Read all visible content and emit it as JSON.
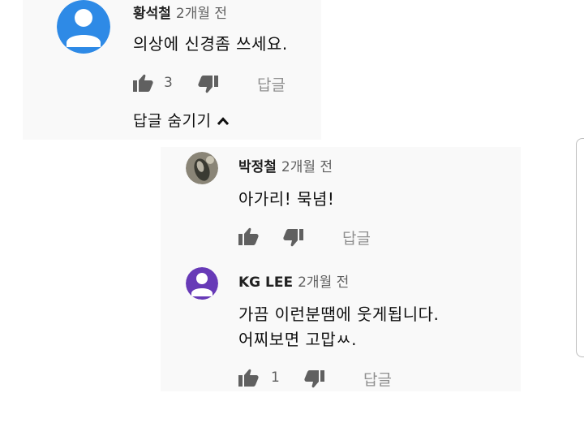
{
  "colors": {
    "avatar_blue": "#2e8ae6",
    "avatar_purple": "#673ab7",
    "icon_gray": "#606060",
    "panel_bg": "#f9f9f9"
  },
  "comment": {
    "author": "황석철",
    "time": "2개월 전",
    "text": "의상에 신경좀 쓰세요.",
    "like_count": "3",
    "reply_label": "답글",
    "hide_replies_label": "답글 숨기기"
  },
  "replies": [
    {
      "author": "박정철",
      "time": "2개월 전",
      "text_lines": [
        "아가리! 묵념!"
      ],
      "like_count": "",
      "reply_label": "답글"
    },
    {
      "author": "KG LEE",
      "time": "2개월 전",
      "text_lines": [
        "가끔 이런분땜에 웃게됩니다.",
        "어찌보면 고맙ㅆ."
      ],
      "like_count": "1",
      "reply_label": "답글"
    }
  ],
  "icons": {
    "like": "thumbs-up-icon",
    "dislike": "thumbs-down-icon",
    "chevron": "chevron-up-icon",
    "default_avatar": "person-avatar-icon"
  }
}
